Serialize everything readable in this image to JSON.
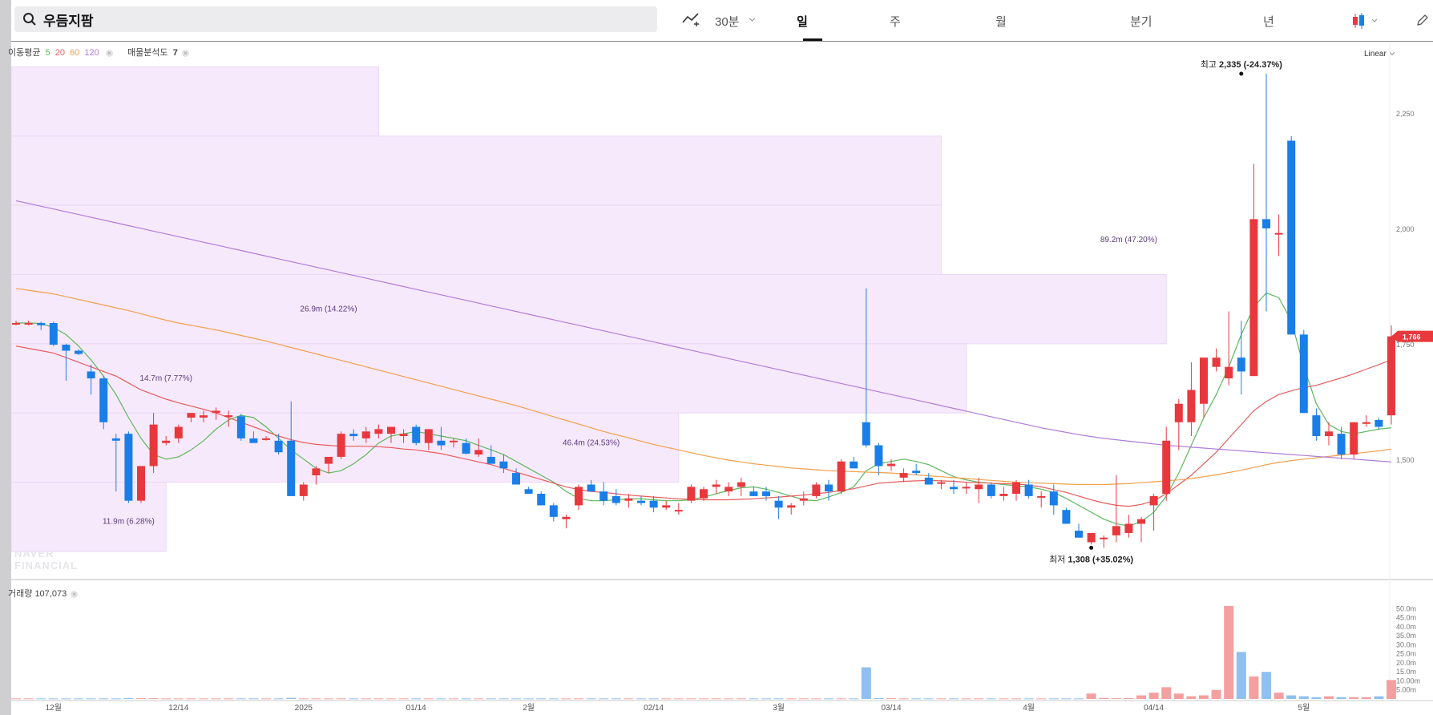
{
  "header": {
    "stock_name": "우듬지팜",
    "interval_label": "30분",
    "periods": [
      "일",
      "주",
      "월",
      "분기",
      "년"
    ],
    "active_period": "일"
  },
  "legend": {
    "ma_title": "이동평균",
    "ma_periods": [
      "5",
      "20",
      "60",
      "120"
    ],
    "ma_colors": [
      "#5cb85c",
      "#e85c5c",
      "#f0a04b",
      "#b07cd8"
    ],
    "volume_profile_label": "매물분석도",
    "volume_profile_count": "7",
    "volume_label": "거래량",
    "volume_value": "107,073"
  },
  "watermark": [
    "NAVER",
    "FINANCIAL"
  ],
  "scale_mode": "Linear",
  "colors": {
    "up": "#e8383d",
    "down": "#1a7ee8",
    "vol_up": "#f4a0a0",
    "vol_down": "#8fc0f0",
    "profile": "#f7e9fc"
  },
  "chart_data": {
    "type": "candlestick",
    "price_axis": {
      "min": 1250,
      "max": 2400,
      "ticks": [
        1500,
        1750,
        2000,
        2250
      ],
      "tick_labels": [
        "1,500",
        "1,750",
        "2,000",
        "2,250"
      ]
    },
    "current_price": {
      "value": 1766,
      "label": "1,766"
    },
    "high_marker": {
      "label": "최고",
      "value_text": "2,335",
      "change": "(-24.37%)",
      "index": 98,
      "price": 2335
    },
    "low_marker": {
      "label": "최저",
      "value_text": "1,308",
      "change": "(+35.02%)",
      "index": 86,
      "price": 1308
    },
    "x_labels": [
      {
        "text": "12월",
        "index": 3
      },
      {
        "text": "12/14",
        "index": 13
      },
      {
        "text": "2025",
        "index": 23
      },
      {
        "text": "01/14",
        "index": 32
      },
      {
        "text": "2월",
        "index": 41
      },
      {
        "text": "02/14",
        "index": 51
      },
      {
        "text": "3월",
        "index": 61
      },
      {
        "text": "03/14",
        "index": 70
      },
      {
        "text": "4월",
        "index": 81
      },
      {
        "text": "04/14",
        "index": 91
      },
      {
        "text": "5월",
        "index": 103
      }
    ],
    "volume_axis": [
      "50.0m",
      "45.0m",
      "40.0m",
      "35.0m",
      "30.0m",
      "25.0m",
      "20.0m",
      "15.0m",
      "10.00m",
      "5.00m"
    ],
    "volume_max": 55,
    "volume_profile": [
      {
        "low": 2200,
        "high": 2350,
        "end_index": 29,
        "label": ""
      },
      {
        "low": 2050,
        "high": 2200,
        "end_index": 74,
        "label": ""
      },
      {
        "low": 1900,
        "high": 2050,
        "end_index": 74,
        "label": ""
      },
      {
        "low": 1750,
        "high": 1900,
        "end_index": 92,
        "label": "89.2m (47.20%)",
        "label_index": 89,
        "label_price": 1970
      },
      {
        "low": 1600,
        "high": 1750,
        "end_index": 76,
        "label": "26.9m (14.22%)",
        "label_index": 25,
        "label_price": 1820
      },
      {
        "low": 1450,
        "high": 1600,
        "end_index": 53,
        "label": "46.4m (24.53%)",
        "label_index": 46,
        "label_price": 1530
      },
      {
        "low": 1300,
        "high": 1450,
        "end_index": 12,
        "label": "14.7m (7.77%)",
        "label_index": 12,
        "label_price": 1670
      },
      {
        "low": 1300,
        "high": 1300,
        "end_index": 12,
        "label": "11.9m (6.28%)",
        "label_index": 9,
        "label_price": 1360
      }
    ],
    "candles": [
      [
        1795,
        1800,
        1790,
        1795
      ],
      [
        1795,
        1800,
        1790,
        1795
      ],
      [
        1795,
        1798,
        1780,
        1790
      ],
      [
        1795,
        1798,
        1745,
        1748
      ],
      [
        1748,
        1750,
        1670,
        1735
      ],
      [
        1735,
        1738,
        1725,
        1728
      ],
      [
        1690,
        1705,
        1640,
        1675
      ],
      [
        1675,
        1680,
        1565,
        1580
      ],
      [
        1545,
        1555,
        1430,
        1540
      ],
      [
        1555,
        1560,
        1405,
        1410
      ],
      [
        1410,
        1480,
        1405,
        1485
      ],
      [
        1485,
        1600,
        1470,
        1575
      ],
      [
        1535,
        1550,
        1530,
        1540
      ],
      [
        1545,
        1575,
        1535,
        1570
      ],
      [
        1590,
        1600,
        1580,
        1600
      ],
      [
        1590,
        1605,
        1580,
        1595
      ],
      [
        1600,
        1612,
        1585,
        1605
      ],
      [
        1595,
        1605,
        1570,
        1595
      ],
      [
        1593,
        1598,
        1540,
        1545
      ],
      [
        1545,
        1560,
        1535,
        1535
      ],
      [
        1545,
        1550,
        1540,
        1545
      ],
      [
        1540,
        1555,
        1510,
        1515
      ],
      [
        1540,
        1625,
        1420,
        1420
      ],
      [
        1420,
        1450,
        1410,
        1445
      ],
      [
        1465,
        1485,
        1445,
        1480
      ],
      [
        1490,
        1505,
        1470,
        1505
      ],
      [
        1505,
        1560,
        1500,
        1555
      ],
      [
        1555,
        1565,
        1540,
        1550
      ],
      [
        1545,
        1570,
        1535,
        1560
      ],
      [
        1555,
        1575,
        1545,
        1565
      ],
      [
        1555,
        1570,
        1535,
        1570
      ],
      [
        1550,
        1565,
        1535,
        1555
      ],
      [
        1570,
        1575,
        1530,
        1535
      ],
      [
        1535,
        1565,
        1520,
        1565
      ],
      [
        1540,
        1570,
        1520,
        1530
      ],
      [
        1540,
        1545,
        1525,
        1540
      ],
      [
        1535,
        1545,
        1510,
        1512
      ],
      [
        1510,
        1545,
        1505,
        1520
      ],
      [
        1505,
        1530,
        1495,
        1490
      ],
      [
        1495,
        1510,
        1470,
        1480
      ],
      [
        1470,
        1480,
        1445,
        1445
      ],
      [
        1435,
        1440,
        1425,
        1425
      ],
      [
        1425,
        1430,
        1400,
        1400
      ],
      [
        1400,
        1405,
        1365,
        1375
      ],
      [
        1370,
        1380,
        1350,
        1375
      ],
      [
        1400,
        1445,
        1390,
        1440
      ],
      [
        1445,
        1455,
        1430,
        1430
      ],
      [
        1430,
        1450,
        1400,
        1410
      ],
      [
        1420,
        1435,
        1400,
        1405
      ],
      [
        1410,
        1425,
        1395,
        1415
      ],
      [
        1410,
        1420,
        1400,
        1405
      ],
      [
        1410,
        1420,
        1385,
        1395
      ],
      [
        1395,
        1410,
        1390,
        1400
      ],
      [
        1390,
        1405,
        1380,
        1390
      ],
      [
        1410,
        1445,
        1405,
        1440
      ],
      [
        1415,
        1440,
        1410,
        1435
      ],
      [
        1440,
        1455,
        1425,
        1445
      ],
      [
        1430,
        1450,
        1420,
        1440
      ],
      [
        1440,
        1460,
        1420,
        1450
      ],
      [
        1430,
        1440,
        1420,
        1420
      ],
      [
        1430,
        1440,
        1410,
        1420
      ],
      [
        1410,
        1420,
        1370,
        1395
      ],
      [
        1395,
        1405,
        1380,
        1400
      ],
      [
        1410,
        1430,
        1400,
        1415
      ],
      [
        1420,
        1450,
        1415,
        1445
      ],
      [
        1445,
        1455,
        1410,
        1430
      ],
      [
        1430,
        1500,
        1425,
        1495
      ],
      [
        1495,
        1505,
        1480,
        1480
      ],
      [
        1580,
        1870,
        1525,
        1530
      ],
      [
        1530,
        1535,
        1465,
        1485
      ],
      [
        1485,
        1500,
        1475,
        1490
      ],
      [
        1460,
        1480,
        1450,
        1470
      ],
      [
        1475,
        1490,
        1465,
        1470
      ],
      [
        1460,
        1470,
        1445,
        1445
      ],
      [
        1450,
        1455,
        1435,
        1450
      ],
      [
        1440,
        1455,
        1425,
        1435
      ],
      [
        1440,
        1450,
        1425,
        1440
      ],
      [
        1435,
        1460,
        1405,
        1445
      ],
      [
        1445,
        1450,
        1415,
        1420
      ],
      [
        1420,
        1440,
        1410,
        1425
      ],
      [
        1425,
        1455,
        1410,
        1450
      ],
      [
        1445,
        1455,
        1415,
        1420
      ],
      [
        1420,
        1430,
        1395,
        1420
      ],
      [
        1430,
        1445,
        1380,
        1400
      ],
      [
        1390,
        1395,
        1360,
        1360
      ],
      [
        1345,
        1360,
        1330,
        1330
      ],
      [
        1320,
        1340,
        1315,
        1340
      ],
      [
        1328,
        1335,
        1308,
        1330
      ],
      [
        1335,
        1465,
        1320,
        1355
      ],
      [
        1340,
        1380,
        1330,
        1360
      ],
      [
        1360,
        1375,
        1320,
        1370
      ],
      [
        1400,
        1425,
        1345,
        1420
      ],
      [
        1425,
        1570,
        1410,
        1540
      ],
      [
        1580,
        1630,
        1520,
        1620
      ],
      [
        1580,
        1710,
        1550,
        1650
      ],
      [
        1620,
        1700,
        1590,
        1720
      ],
      [
        1700,
        1740,
        1690,
        1720
      ],
      [
        1675,
        1820,
        1660,
        1700
      ],
      [
        1720,
        1800,
        1640,
        1690
      ],
      [
        1680,
        2140,
        1700,
        2020
      ],
      [
        2020,
        2335,
        1820,
        2000
      ],
      [
        1990,
        2030,
        1940,
        1990
      ],
      [
        2190,
        2200,
        1770,
        1770
      ],
      [
        1770,
        1780,
        1600,
        1600
      ],
      [
        1595,
        1610,
        1540,
        1550
      ],
      [
        1550,
        1580,
        1530,
        1560
      ],
      [
        1555,
        1570,
        1500,
        1510
      ],
      [
        1510,
        1580,
        1500,
        1580
      ],
      [
        1580,
        1595,
        1570,
        1580
      ],
      [
        1585,
        1590,
        1565,
        1570
      ],
      [
        1595,
        1790,
        1575,
        1766
      ]
    ],
    "ma": {
      "ma5": [
        1795,
        1795,
        1794,
        1785,
        1770,
        1745,
        1715,
        1680,
        1640,
        1590,
        1545,
        1510,
        1500,
        1505,
        1520,
        1540,
        1565,
        1585,
        1595,
        1590,
        1570,
        1545,
        1520,
        1500,
        1480,
        1470,
        1475,
        1490,
        1510,
        1535,
        1550,
        1555,
        1560,
        1555,
        1550,
        1545,
        1540,
        1530,
        1520,
        1510,
        1495,
        1480,
        1465,
        1450,
        1430,
        1415,
        1410,
        1410,
        1412,
        1414,
        1414,
        1412,
        1410,
        1410,
        1412,
        1418,
        1425,
        1432,
        1438,
        1440,
        1435,
        1428,
        1420,
        1412,
        1410,
        1418,
        1428,
        1440,
        1475,
        1490,
        1495,
        1500,
        1495,
        1488,
        1475,
        1462,
        1455,
        1450,
        1448,
        1445,
        1442,
        1440,
        1435,
        1428,
        1415,
        1400,
        1385,
        1370,
        1360,
        1355,
        1365,
        1385,
        1420,
        1470,
        1530,
        1590,
        1640,
        1700,
        1770,
        1830,
        1860,
        1850,
        1800,
        1700,
        1620,
        1575,
        1560,
        1555,
        1560,
        1565,
        1568
      ],
      "ma20": [
        1745,
        1740,
        1735,
        1730,
        1720,
        1710,
        1700,
        1690,
        1680,
        1665,
        1650,
        1640,
        1630,
        1622,
        1615,
        1608,
        1600,
        1590,
        1580,
        1570,
        1560,
        1550,
        1542,
        1536,
        1532,
        1530,
        1528,
        1528,
        1528,
        1527,
        1525,
        1522,
        1520,
        1516,
        1512,
        1506,
        1500,
        1494,
        1488,
        1480,
        1472,
        1464,
        1456,
        1448,
        1440,
        1434,
        1430,
        1428,
        1425,
        1422,
        1420,
        1418,
        1416,
        1414,
        1413,
        1412,
        1412,
        1412,
        1413,
        1414,
        1416,
        1418,
        1420,
        1422,
        1425,
        1428,
        1432,
        1436,
        1442,
        1448,
        1450,
        1452,
        1453,
        1454,
        1453,
        1452,
        1450,
        1449,
        1448,
        1447,
        1446,
        1444,
        1440,
        1434,
        1428,
        1420,
        1412,
        1405,
        1400,
        1398,
        1402,
        1410,
        1425,
        1445,
        1465,
        1490,
        1515,
        1545,
        1575,
        1605,
        1625,
        1640,
        1648,
        1655,
        1660,
        1668,
        1676,
        1685,
        1695,
        1705,
        1715
      ],
      "ma60": [
        1870,
        1866,
        1862,
        1858,
        1852,
        1846,
        1840,
        1834,
        1828,
        1822,
        1815,
        1808,
        1801,
        1795,
        1790,
        1785,
        1780,
        1774,
        1768,
        1762,
        1756,
        1749,
        1742,
        1735,
        1728,
        1721,
        1714,
        1707,
        1700,
        1693,
        1686,
        1679,
        1672,
        1665,
        1658,
        1651,
        1644,
        1637,
        1630,
        1623,
        1616,
        1608,
        1600,
        1592,
        1584,
        1576,
        1568,
        1560,
        1553,
        1546,
        1539,
        1532,
        1526,
        1520,
        1514,
        1508,
        1503,
        1498,
        1494,
        1490,
        1487,
        1484,
        1481,
        1479,
        1477,
        1475,
        1474,
        1473,
        1472,
        1471,
        1470,
        1468,
        1466,
        1464,
        1462,
        1460,
        1458,
        1456,
        1454,
        1452,
        1450,
        1449,
        1448,
        1447,
        1446,
        1445,
        1445,
        1445,
        1446,
        1447,
        1449,
        1451,
        1453,
        1455,
        1458,
        1462,
        1466,
        1471,
        1476,
        1482,
        1488,
        1493,
        1497,
        1500,
        1503,
        1506,
        1509,
        1512,
        1515,
        1518,
        1522
      ],
      "ma120": [
        2060,
        2054,
        2048,
        2042,
        2036,
        2030,
        2024,
        2018,
        2012,
        2006,
        2000,
        1994,
        1988,
        1982,
        1976,
        1970,
        1964,
        1958,
        1952,
        1946,
        1940,
        1934,
        1928,
        1922,
        1916,
        1910,
        1904,
        1898,
        1892,
        1886,
        1880,
        1874,
        1868,
        1862,
        1856,
        1850,
        1844,
        1838,
        1832,
        1826,
        1820,
        1814,
        1808,
        1802,
        1796,
        1790,
        1784,
        1778,
        1772,
        1766,
        1760,
        1754,
        1748,
        1742,
        1736,
        1730,
        1724,
        1718,
        1712,
        1706,
        1700,
        1694,
        1688,
        1682,
        1676,
        1670,
        1664,
        1658,
        1652,
        1646,
        1640,
        1634,
        1628,
        1622,
        1616,
        1610,
        1604,
        1598,
        1592,
        1586,
        1580,
        1574,
        1568,
        1563,
        1558,
        1553,
        1549,
        1545,
        1542,
        1539,
        1536,
        1533,
        1530,
        1528,
        1526,
        1524,
        1522,
        1520,
        1518,
        1516,
        1514,
        1512,
        1510,
        1508,
        1506,
        1504,
        1502,
        1500,
        1498,
        1496,
        1494
      ]
    },
    "volume": [
      0.3,
      0.3,
      0.3,
      0.3,
      0.3,
      0.3,
      0.3,
      0.3,
      0.3,
      0.5,
      0.4,
      0.4,
      0.3,
      0.3,
      0.3,
      0.3,
      0.3,
      0.3,
      0.3,
      0.3,
      0.3,
      0.3,
      0.6,
      0.3,
      0.3,
      0.3,
      0.3,
      0.3,
      0.3,
      0.3,
      0.3,
      0.3,
      0.3,
      0.3,
      0.3,
      0.3,
      0.3,
      0.3,
      0.3,
      0.3,
      0.3,
      0.3,
      0.3,
      0.3,
      0.3,
      0.3,
      0.3,
      0.3,
      0.3,
      0.3,
      0.3,
      0.3,
      0.3,
      0.3,
      0.3,
      0.3,
      0.3,
      0.3,
      0.3,
      0.3,
      0.3,
      0.3,
      0.3,
      0.3,
      0.3,
      0.3,
      0.3,
      0.3,
      17.5,
      0.5,
      0.4,
      0.3,
      0.3,
      0.3,
      0.3,
      0.3,
      0.3,
      0.3,
      0.3,
      0.3,
      0.3,
      0.3,
      0.3,
      0.3,
      0.3,
      0.3,
      3.0,
      0.6,
      0.4,
      0.5,
      2.0,
      3.5,
      6.5,
      3.0,
      1.5,
      2.0,
      5.0,
      51.5,
      26.0,
      12.5,
      15.0,
      3.5,
      2.0,
      1.5,
      1.0,
      1.5,
      1.0,
      1.0,
      1.0,
      1.5,
      10.5
    ]
  }
}
